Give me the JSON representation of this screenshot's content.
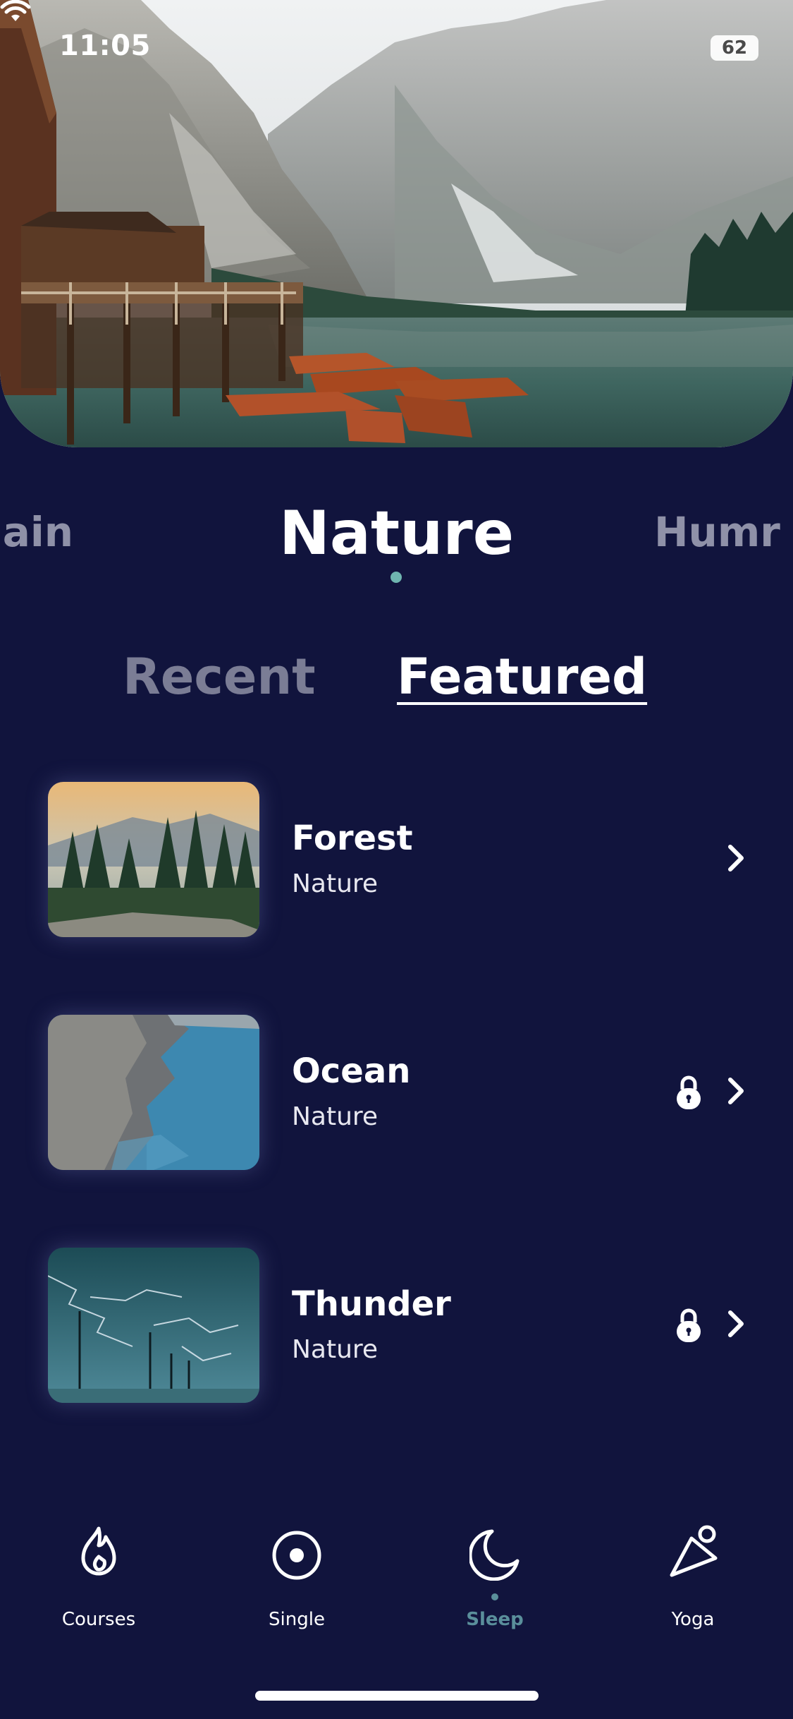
{
  "status_bar": {
    "time": "11:05",
    "battery": "62"
  },
  "categories": {
    "previous": "ain",
    "current": "Nature",
    "next": "Humr"
  },
  "tabs": [
    {
      "label": "Recent",
      "active": false
    },
    {
      "label": "Featured",
      "active": true
    }
  ],
  "items": [
    {
      "title": "Forest",
      "subtitle": "Nature",
      "locked": false
    },
    {
      "title": "Ocean",
      "subtitle": "Nature",
      "locked": true
    },
    {
      "title": "Thunder",
      "subtitle": "Nature",
      "locked": true
    }
  ],
  "nav": [
    {
      "label": "Courses",
      "icon": "flame-icon",
      "active": false
    },
    {
      "label": "Single",
      "icon": "circle-dot-icon",
      "active": false
    },
    {
      "label": "Sleep",
      "icon": "moon-icon",
      "active": true
    },
    {
      "label": "Yoga",
      "icon": "yoga-pose-icon",
      "active": false
    }
  ],
  "colors": {
    "background": "#11143d",
    "accent": "#5a8f9b",
    "indicator_dot": "#6fb5b0",
    "muted_text": "#7b7d95"
  }
}
